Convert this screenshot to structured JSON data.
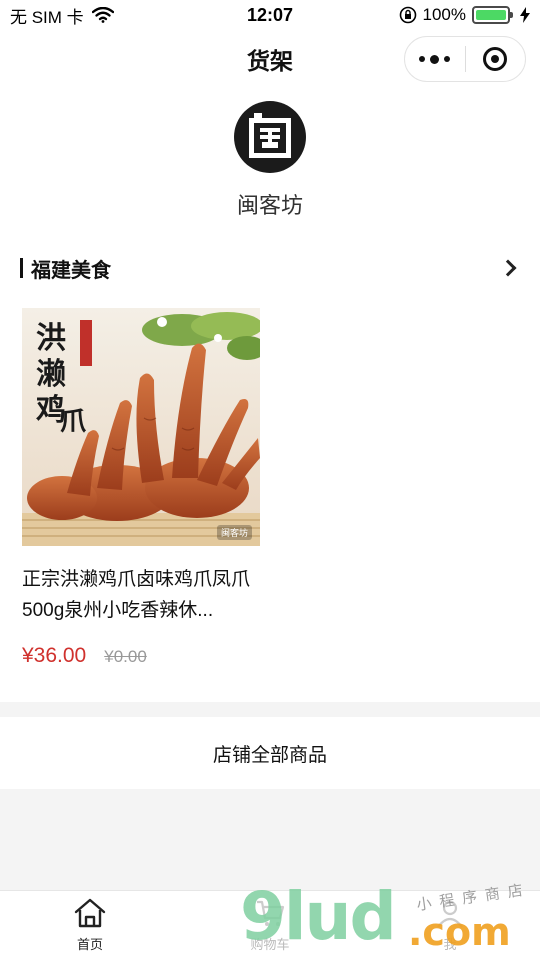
{
  "status_bar": {
    "carrier": "无 SIM 卡",
    "time": "12:07",
    "battery_percent": "100%",
    "icons": [
      "wifi-icon",
      "orientation-lock-icon",
      "battery-icon",
      "charging-icon"
    ]
  },
  "nav": {
    "title": "货架",
    "capsule_icons": [
      "more-dots-icon",
      "close-target-icon"
    ]
  },
  "shop": {
    "logo_glyph": "闽",
    "name": "闽客坊"
  },
  "section": {
    "title": "福建美食",
    "icon": "chevron-right-icon"
  },
  "product": {
    "image_text": "洪濑鸡爪",
    "image_stamp": "闽客坊",
    "name": "正宗洪濑鸡爪卤味鸡爪凤爪500g泉州小吃香辣休...",
    "price": "¥36.00",
    "original_price": "¥0.00"
  },
  "all_products_label": "店铺全部商品",
  "tab_bar": {
    "tabs": [
      {
        "label": "首页",
        "icon": "home-icon"
      },
      {
        "label": "购物车",
        "icon": "cart-icon"
      },
      {
        "label": "我",
        "icon": "person-icon"
      }
    ]
  },
  "watermark": {
    "text": "9lud",
    "domain": ".com",
    "tagline": "小程序商店"
  },
  "colors": {
    "price": "#d0312d",
    "battery": "#4cd964",
    "watermark_green": "#7fd0a0",
    "watermark_orange": "#f0a020"
  }
}
